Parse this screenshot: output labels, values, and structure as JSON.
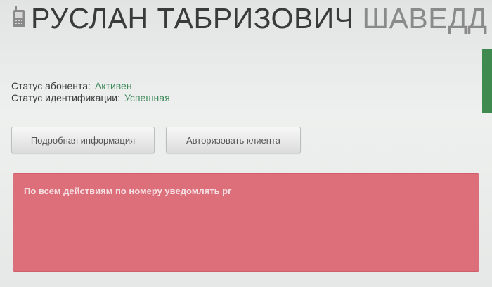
{
  "header": {
    "icon": "mobile-phone-icon",
    "name_first": "РУСЛАН ТАБРИЗОВИЧ",
    "name_last": "ШАВЕДД"
  },
  "status": {
    "subscriber_label": "Статус абонента:",
    "subscriber_value": "Активен",
    "identification_label": "Статус идентификации:",
    "identification_value": "Успешная"
  },
  "buttons": {
    "details_label": "Подробная информация",
    "authorize_label": "Авторизовать клиента"
  },
  "alert": {
    "text": "По всем действиям по номеру уведомлять рг"
  },
  "colors": {
    "status_value": "#3f8a5c",
    "alert_background": "#dd6f7b",
    "alert_text": "#f6dfe2",
    "accent_strip": "#3f8a4e"
  }
}
